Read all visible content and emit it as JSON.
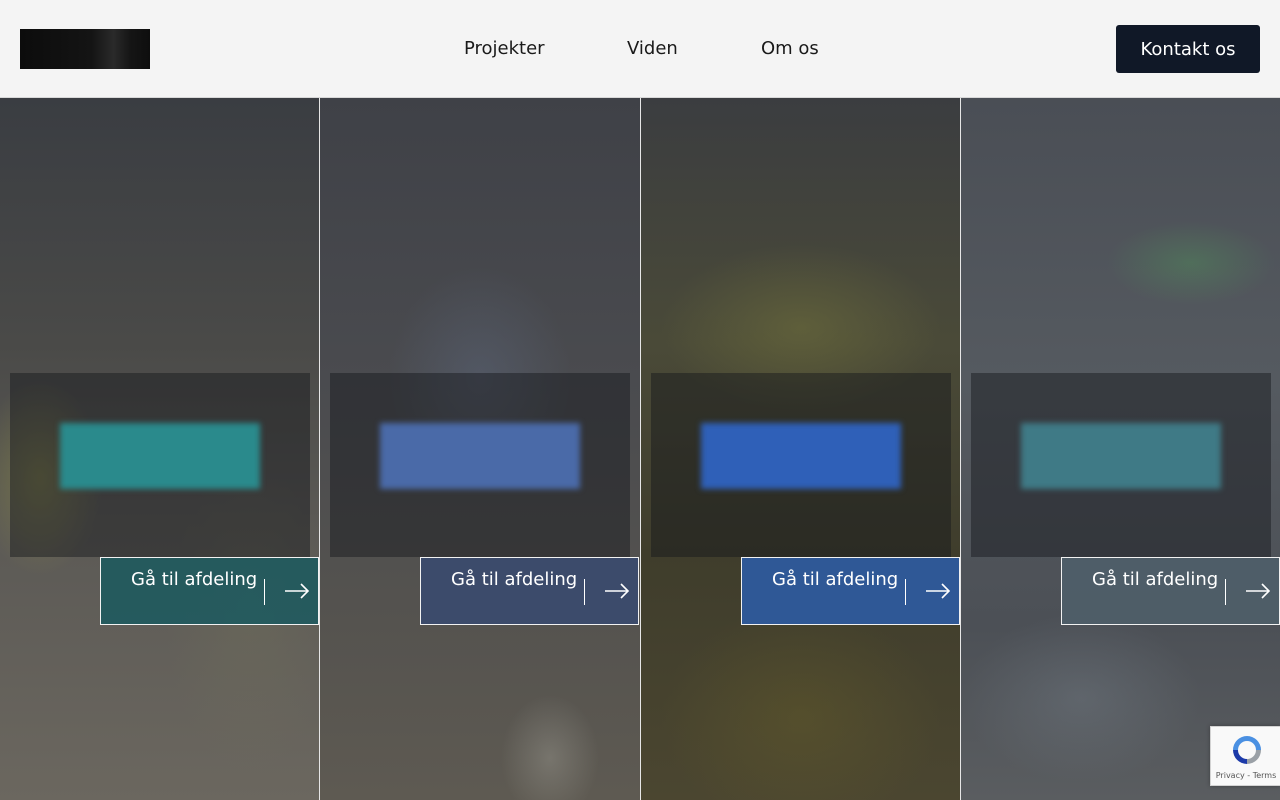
{
  "header": {
    "nav": [
      "Projekter",
      "Viden",
      "Om os"
    ],
    "contact_label": "Kontakt os"
  },
  "panels": [
    {
      "button_label": "Gå til afdeling",
      "accent": "#1f5a5e",
      "chip": "#2a8a8c"
    },
    {
      "button_label": "Gå til afdeling",
      "accent": "#3a4a6e",
      "chip": "#4a6aa8"
    },
    {
      "button_label": "Gå til afdeling",
      "accent": "#2e5aa0",
      "chip": "#2f60b8"
    },
    {
      "button_label": "Gå til afdeling",
      "accent": "#4f5f6a",
      "chip": "#3f7a86"
    }
  ],
  "recaptcha": {
    "links": "Privacy - Terms"
  },
  "colors": {
    "primary_dark": "#101827",
    "header_bg": "#f4f4f4"
  }
}
